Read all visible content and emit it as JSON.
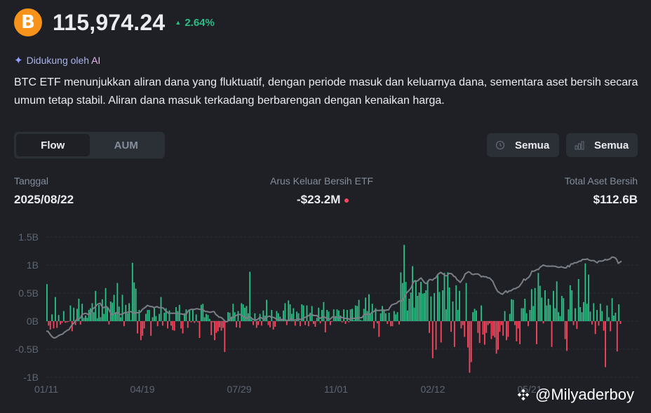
{
  "header": {
    "logo_symbol": "B",
    "price": "115,974.24",
    "change": "2.64%",
    "change_arrow": "▲",
    "positive_color": "#2ebd85",
    "negative_color": "#f6465d",
    "accent": "#f7931a"
  },
  "ai": {
    "prefix": "Didukung oleh",
    "ai_label": "AI",
    "icon": "sparkle-icon"
  },
  "summary": "BTC ETF menunjukkan aliran dana yang fluktuatif, dengan periode masuk dan keluarnya dana, sementara aset bersih secara umum tetap stabil. Aliran dana masuk terkadang berbarengan dengan kenaikan harga.",
  "tabs": [
    {
      "label": "Flow",
      "active": true
    },
    {
      "label": "AUM",
      "active": false
    }
  ],
  "filters": [
    {
      "label": "Semua",
      "icon": "clock-icon"
    },
    {
      "label": "Semua",
      "icon": "bar-chart-icon"
    }
  ],
  "stats": {
    "date_label": "Tanggal",
    "date_value": "2025/08/22",
    "flow_label": "Arus Keluar Bersih ETF",
    "flow_value": "-$23.2M",
    "aum_label": "Total Aset Bersih",
    "aum_value": "$112.6B"
  },
  "chart_data": {
    "type": "bar",
    "ylim": [
      -1,
      1.5
    ],
    "yticks": [
      "1.5B",
      "1B",
      "0.5B",
      "0B",
      "-0.5B",
      "-1B"
    ],
    "xticks": [
      "01/11",
      "04/19",
      "07/29",
      "11/01",
      "02/12",
      "05/21"
    ],
    "bar_pos_color": "#2ebd85",
    "bar_neg_color": "#f6465d",
    "line_color": "#7a7f87",
    "grid": true,
    "series": [
      {
        "type": "bar",
        "values": [
          0.66,
          -0.08,
          -0.15,
          0.12,
          -0.13,
          0.43,
          -0.12,
          0.11,
          -0.06,
          -0.03,
          0.18,
          -0.03,
          -0.02,
          -0.01,
          0.28,
          -0.18,
          0.24,
          -0.07,
          0.22,
          0.4,
          -0.06,
          0.31,
          0.06,
          0.1,
          0.06,
          0.2,
          0.23,
          0.32,
          0.16,
          0.54,
          0.05,
          0.29,
          0.07,
          0.39,
          0.13,
          0.59,
          0.24,
          -0.06,
          0.35,
          0.33,
          0.47,
          0.15,
          0.68,
          0.26,
          0.07,
          0.47,
          -0.09,
          0.29,
          0.14,
          0.32,
          0.02,
          1.04,
          0.69,
          0.58,
          -0.22,
          0.2,
          -0.34,
          -0.26,
          -0.13,
          0.13,
          0.2,
          0.2,
          -0.26,
          0.07,
          0.23,
          0.09,
          -0.09,
          0.13,
          0.43,
          -0.08,
          0.15,
          0.23,
          -0.13,
          0.19,
          -0.08,
          -0.16,
          -0.17,
          0.25,
          0.18,
          0.29,
          -0.13,
          -0.22,
          0.14,
          0.21,
          -0.12,
          0.21,
          -0.02,
          0.21,
          -0.03,
          0.12,
          -0.02,
          -0.3,
          0.29,
          0.31,
          0.07,
          0.13,
          0.11,
          0.04,
          -0.25,
          -0.02,
          -0.34,
          -0.21,
          -0.18,
          -0.11,
          -0.17,
          -0.12,
          -0.55,
          -0.02,
          0.16,
          0.15,
          0.08,
          0.31,
          0.16,
          -0.11,
          0.18,
          -0.12,
          0.32,
          0.3,
          0.24,
          0.27,
          0.14,
          0.88,
          0.03,
          -0.07,
          0.14,
          -0.12,
          -0.07,
          0.13,
          -0.08,
          0.19,
          0.1,
          0.38,
          -0.07,
          -0.11,
          0.2,
          -0.15,
          -0.1,
          0.18,
          0.14,
          0.08,
          0.04,
          0.19,
          0.32,
          -0.07,
          0.37,
          0.3,
          0.13,
          0.23,
          -0.08,
          0.17,
          0.14,
          -0.09,
          0.3,
          0.28,
          -0.07,
          0.28,
          -0.09,
          0.15,
          0.27,
          -0.05,
          -0.1,
          0.06,
          0.24,
          -0.04,
          0.2,
          0.34,
          -0.2,
          0.2,
          0.17,
          -0.07,
          -0.01,
          0.21,
          0.09,
          0.21,
          0.19,
          0.1,
          -0.02,
          0.21,
          -0.05,
          0.2,
          -0.02,
          0.21,
          0.22,
          0.02,
          0.28,
          0.27,
          0.38,
          0.02,
          0.01,
          0.22,
          0.42,
          0.18,
          0.48,
          0.12,
          0.31,
          -0.13,
          0.23,
          -0.04,
          -0.28,
          0.14,
          0.27,
          0.21,
          0.14,
          -0.05,
          0.15,
          -0.09,
          -0.09,
          0.18,
          0.12,
          0.16,
          -0.06,
          0.87,
          0.68,
          1.36,
          0.7,
          0.19,
          0.4,
          0.51,
          0.98,
          0.24,
          0.73,
          0.45,
          0.51,
          0.7,
          0.49,
          0.5,
          0.55,
          0.72,
          -0.21,
          0.44,
          -0.66,
          0.5,
          -0.51,
          0.84,
          0.52,
          -0.38,
          0.55,
          0.86,
          0.21,
          0.87,
          0.6,
          -0.19,
          0.35,
          -0.46,
          0.64,
          0.2,
          0.54,
          -0.13,
          -0.07,
          -0.28,
          0.68,
          -0.47,
          -0.92,
          -0.73,
          0.16,
          0.22,
          0.19,
          -0.21,
          -0.39,
          0.28,
          -0.24,
          -0.42,
          -0.21,
          -0.07,
          -0.04,
          -0.32,
          -0.26,
          -0.29,
          -0.58,
          -0.51,
          -0.19,
          -0.07,
          -0.26,
          0.18,
          -0.34,
          -0.28,
          0.13,
          0.39,
          0.38,
          -0.07,
          -0.36,
          -0.13,
          -0.41,
          0.23,
          0.23,
          0.4,
          0.14,
          -0.09,
          0.2,
          0.57,
          0.27,
          0.59,
          -0.41,
          0.86,
          0.63,
          0.42,
          -0.04,
          0.55,
          0.28,
          0.4,
          0.29,
          -0.46,
          0.54,
          0.23,
          0.71,
          0.16,
          0.09,
          0.45,
          0.41,
          -0.32,
          -0.53,
          0.21,
          0.64,
          0.55,
          -0.07,
          0.23,
          -0.14,
          0.75,
          0.25,
          0.16,
          0.34,
          1.03,
          0.31,
          0.83,
          0.17,
          -0.06,
          0.32,
          -0.23,
          0.2,
          -0.08,
          0.31,
          0.18,
          -0.17,
          -0.82,
          0.28,
          0.07,
          -0.18,
          0.41,
          0.1,
          0.15,
          -0.54,
          0.3,
          -0.05
        ]
      },
      {
        "type": "line",
        "values": [
          -0.18,
          -0.18,
          -0.22,
          -0.26,
          -0.29,
          -0.3,
          -0.29,
          -0.27,
          -0.25,
          -0.24,
          -0.23,
          -0.2,
          -0.18,
          -0.16,
          -0.15,
          -0.1,
          -0.06,
          -0.03,
          0.01,
          0.03,
          0.04,
          0.06,
          0.12,
          0.13,
          0.14,
          0.13,
          0.11,
          0.15,
          0.2,
          0.23,
          0.25,
          0.29,
          0.31,
          0.32,
          0.27,
          0.24,
          0.25,
          0.26,
          0.23,
          0.17,
          0.12,
          0.12,
          0.14,
          0.15,
          0.15,
          0.12,
          0.12,
          0.13,
          0.15,
          0.15,
          0.16,
          0.17,
          0.17,
          0.15,
          0.14,
          0.15,
          0.15,
          0.15,
          0.17,
          0.21,
          0.23,
          0.25,
          0.28,
          0.27,
          0.26,
          0.26,
          0.24,
          0.25,
          0.26,
          0.24,
          0.24,
          0.24,
          0.23,
          0.19,
          0.17,
          0.14,
          0.14,
          0.14,
          0.14,
          0.14,
          0.14,
          0.13,
          0.13,
          0.13,
          0.12,
          0.12,
          0.13,
          0.18,
          0.2,
          0.21,
          0.21,
          0.21,
          0.22,
          0.22,
          0.21,
          0.21,
          0.21,
          0.18,
          0.17,
          0.17,
          0.16,
          0.16,
          0.17,
          0.17,
          0.12,
          0.1,
          0.07,
          0.07,
          0.05,
          0.02,
          -0.01,
          -0.01,
          0.02,
          0.05,
          0.06,
          0.07,
          0.09,
          0.11,
          0.12,
          0.12,
          0.1,
          0.08,
          0.06,
          0.05,
          0.07,
          0.08,
          0.05,
          0.03,
          0.03,
          0.02,
          0.04,
          0.07,
          0.06,
          0.04,
          0.03,
          0.06,
          0.08,
          0.09,
          0.07,
          0.07,
          0.06,
          0.04,
          0.03,
          0.02,
          0.03,
          0.03,
          0.03,
          0.02,
          0.01,
          0.02,
          0.04,
          0.03,
          0.02,
          0.02,
          0.03,
          0.04,
          0.03,
          0.03,
          0.06,
          0.07,
          0.08,
          0.1,
          0.12,
          0.12,
          0.1,
          0.1,
          0.1,
          0.07,
          0.05,
          0.07,
          0.08,
          0.07,
          0.05,
          0.04,
          0.03,
          0.06,
          0.08,
          0.07,
          0.07,
          0.06,
          0.06,
          0.07,
          0.06,
          0.05,
          0.05,
          0.05,
          0.03,
          0.05,
          0.05,
          0.05,
          0.05,
          0.06,
          0.06,
          0.06,
          0.07,
          0.12,
          0.13,
          0.12,
          0.12,
          0.13,
          0.16,
          0.17,
          0.2,
          0.19,
          0.19,
          0.19,
          0.2,
          0.19,
          0.19,
          0.2,
          0.2,
          0.25,
          0.29,
          0.3,
          0.31,
          0.32,
          0.35,
          0.36,
          0.36,
          0.38,
          0.44,
          0.5,
          0.53,
          0.56,
          0.6,
          0.68,
          0.72,
          0.71,
          0.72,
          0.75,
          0.77,
          0.73,
          0.69,
          0.67,
          0.69,
          0.74,
          0.74,
          0.73,
          0.76,
          0.77,
          0.82,
          0.85,
          0.87,
          0.85,
          0.83,
          0.81,
          0.81,
          0.85,
          0.85,
          0.84,
          0.8,
          0.79,
          0.74,
          0.72,
          0.69,
          0.73,
          0.77,
          0.84,
          0.86,
          0.88,
          0.87,
          0.84,
          0.83,
          0.84,
          0.84,
          0.84,
          0.82,
          0.79,
          0.8,
          0.79,
          0.79,
          0.77,
          0.77,
          0.74,
          0.71,
          0.64,
          0.58,
          0.53,
          0.51,
          0.49,
          0.48,
          0.51,
          0.54,
          0.51,
          0.54,
          0.54,
          0.56,
          0.58,
          0.58,
          0.6,
          0.61,
          0.65,
          0.69,
          0.75,
          0.73,
          0.76,
          0.78,
          0.82,
          0.89,
          0.89,
          0.9,
          0.92,
          0.92,
          0.96,
          0.98,
          1.0,
          0.99,
          0.98,
          0.98,
          0.98,
          0.98,
          0.98,
          0.98,
          0.97,
          0.96,
          0.96,
          0.97,
          0.96,
          0.95,
          0.95,
          0.99,
          0.97,
          1.02,
          1.02,
          1.04,
          1.04,
          1.05,
          1.07,
          1.07,
          1.1,
          1.1,
          1.1,
          1.11,
          1.09,
          1.08,
          1.08,
          1.08,
          1.06,
          1.04,
          1.07,
          1.07,
          1.07,
          1.08,
          1.1,
          1.09,
          1.1,
          1.11,
          1.14,
          1.14,
          1.13,
          1.1,
          1.03,
          1.05,
          1.07
        ]
      }
    ]
  },
  "watermark": {
    "handle": "@Milyaderboy",
    "icon": "binance-logo-icon"
  }
}
